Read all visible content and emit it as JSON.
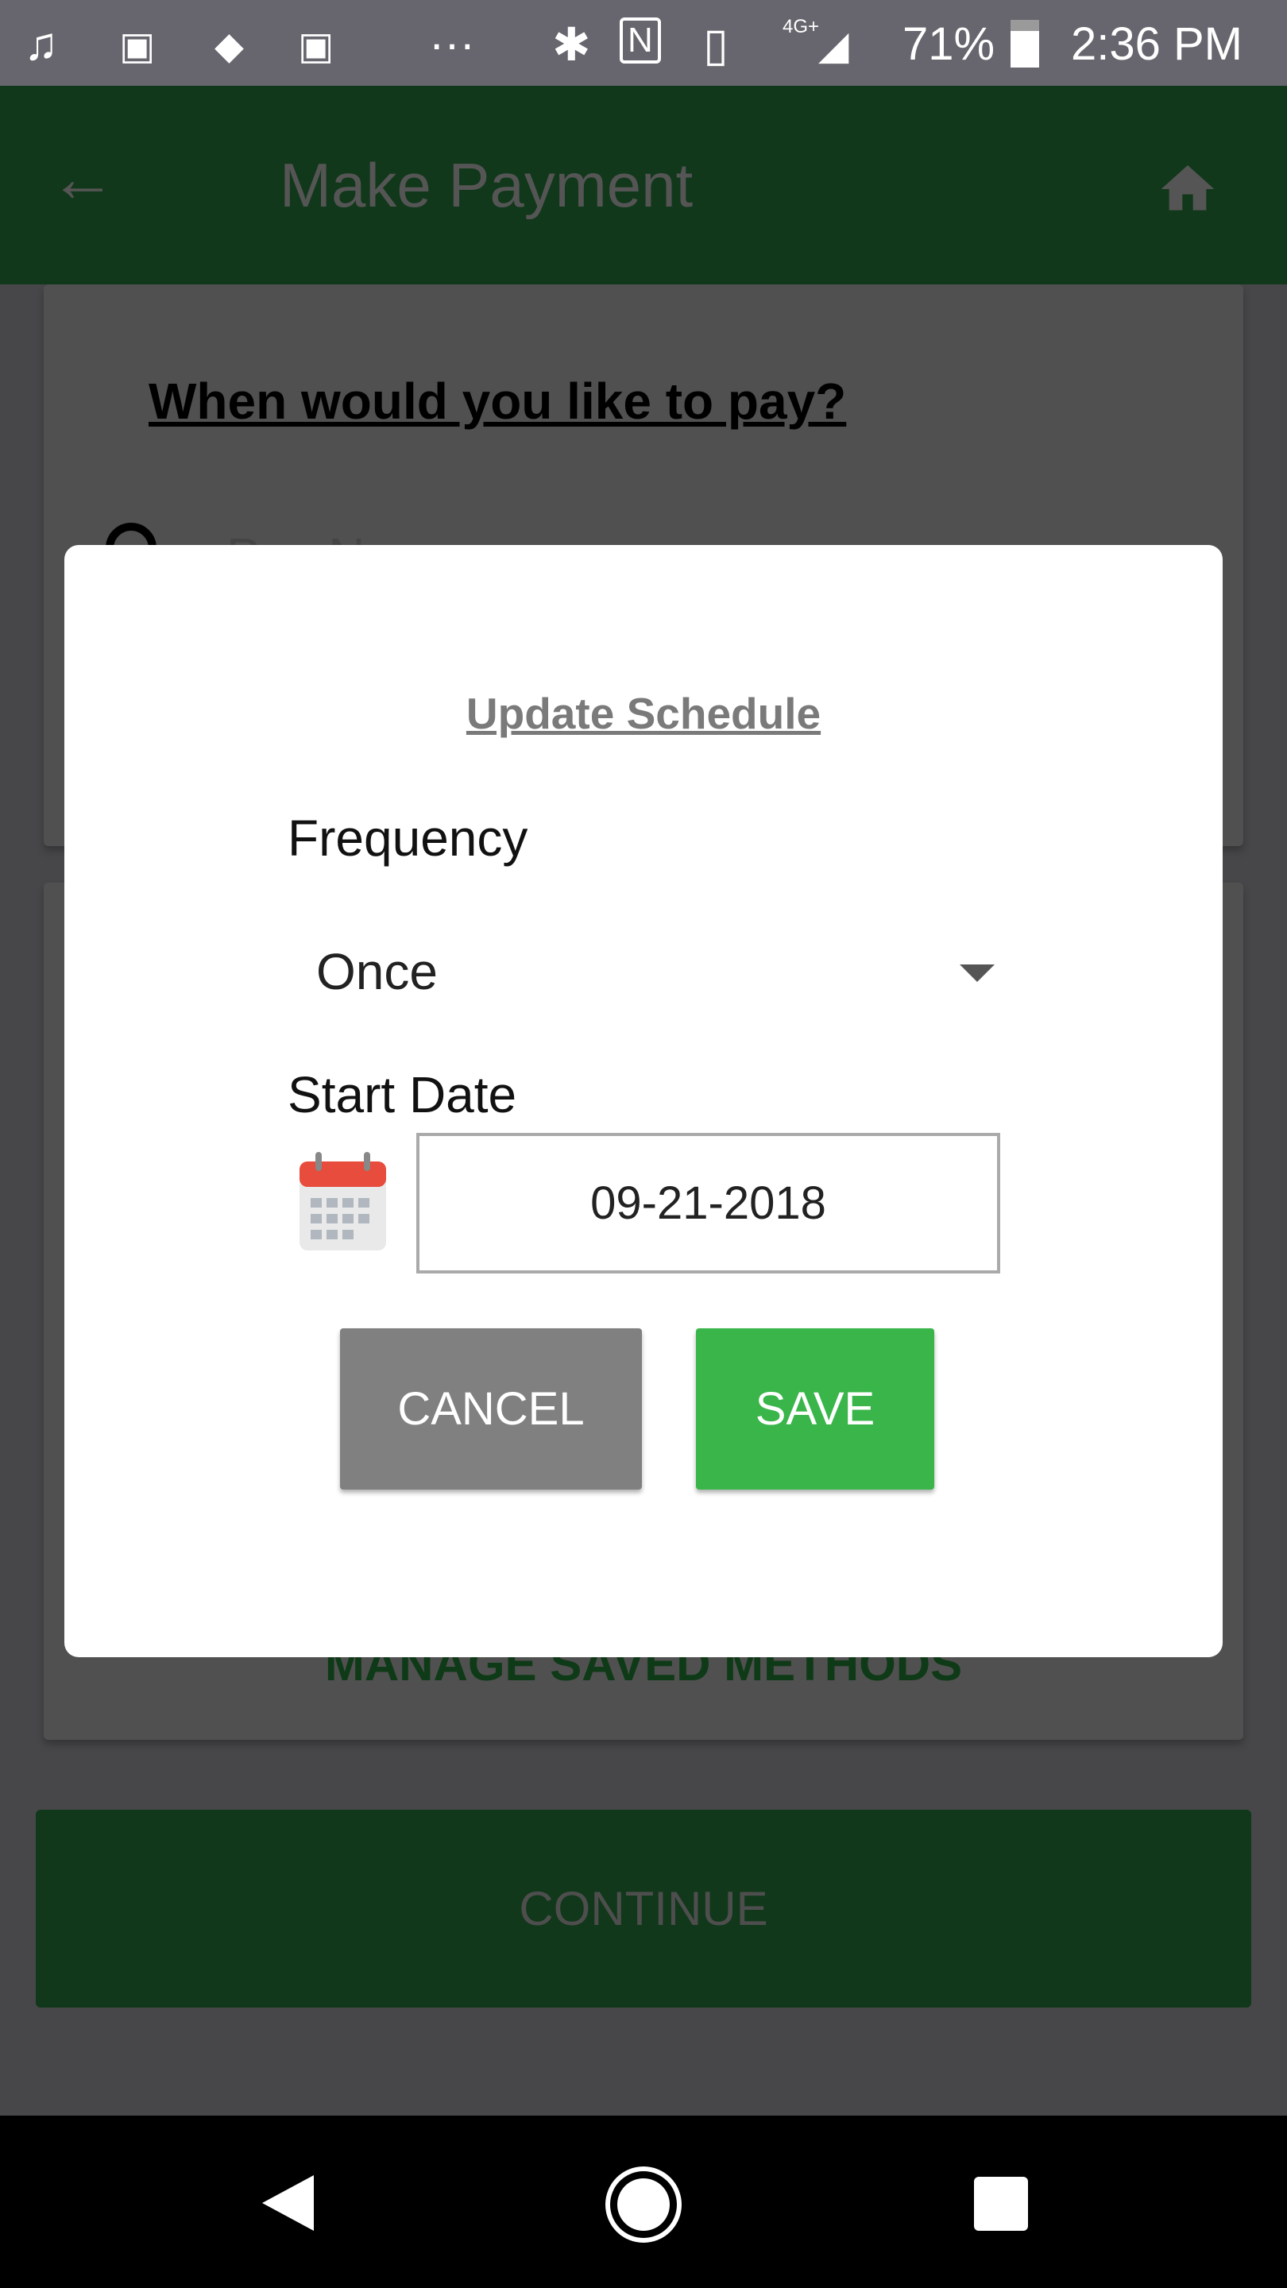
{
  "status_bar": {
    "battery": "71%",
    "time": "2:36 PM",
    "network": "4G+",
    "icons": [
      "music-note-icon",
      "outlook-icon",
      "jira-icon",
      "outlook-icon",
      "more-icon",
      "bluetooth-icon",
      "nfc-icon",
      "vibrate-icon",
      "signal-icon",
      "battery-icon"
    ]
  },
  "app_bar": {
    "title": "Make Payment",
    "back_icon": "arrow-left-icon",
    "home_icon": "home-icon"
  },
  "background": {
    "question": "When would you like to pay?",
    "radio_option": "Pay Now",
    "manage_link": "MANAGE SAVED METHODS",
    "continue_label": "CONTINUE"
  },
  "dialog": {
    "title": "Update Schedule",
    "frequency_label": "Frequency",
    "frequency_value": "Once",
    "start_date_label": "Start Date",
    "start_date_value": "09-21-2018",
    "cancel_label": "CANCEL",
    "save_label": "SAVE"
  },
  "colors": {
    "app_green": "#11381a",
    "save_green": "#39b54a",
    "cancel_gray": "#808080"
  }
}
